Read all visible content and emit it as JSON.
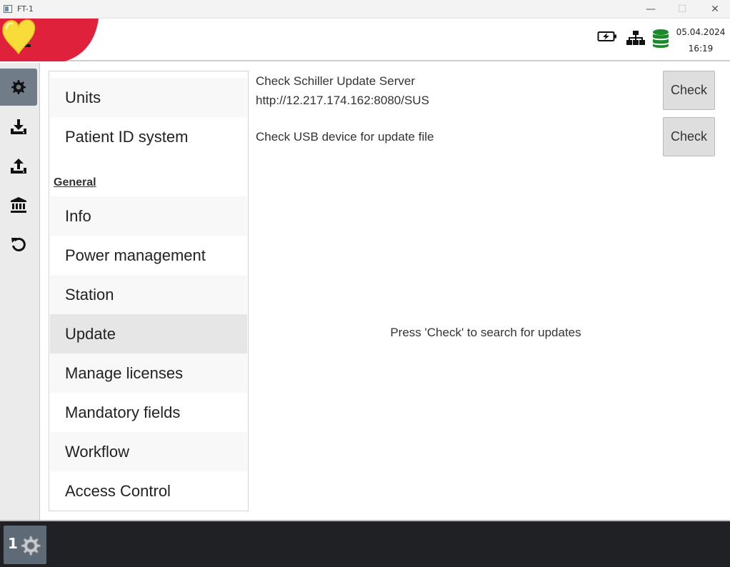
{
  "window": {
    "title": "FT-1",
    "min_glyph": "—",
    "max_glyph": "☐",
    "close_glyph": "✕"
  },
  "header": {
    "date": "05.04.2024",
    "time": "16:19",
    "brand_color": "#e0213c",
    "heart_color": "#f7dc3a",
    "icons": [
      "menu-icon",
      "heart-logo",
      "battery-charging-icon",
      "network-icon",
      "database-icon"
    ],
    "database_color": "#1a8a2a"
  },
  "rail": {
    "items": [
      {
        "name": "settings-icon",
        "active": true
      },
      {
        "name": "download-icon",
        "active": false
      },
      {
        "name": "upload-icon",
        "active": false
      },
      {
        "name": "archive-icon",
        "active": false
      },
      {
        "name": "reset-icon",
        "active": false
      }
    ]
  },
  "settings_list": {
    "items_top": [
      "Units",
      "Patient ID system"
    ],
    "section": "General",
    "items_general": [
      "Info",
      "Power management",
      "Station",
      "Update",
      "Manage licenses",
      "Mandatory fields",
      "Workflow",
      "Access Control"
    ],
    "selected": "Update"
  },
  "update": {
    "server_label": "Check Schiller Update Server",
    "server_url": "http://12.217.174.162:8080/SUS",
    "usb_label": "Check USB device for update file",
    "check_label": "Check",
    "message": "Press 'Check' to search for updates"
  },
  "taskbar": {
    "tile_number": "1"
  }
}
